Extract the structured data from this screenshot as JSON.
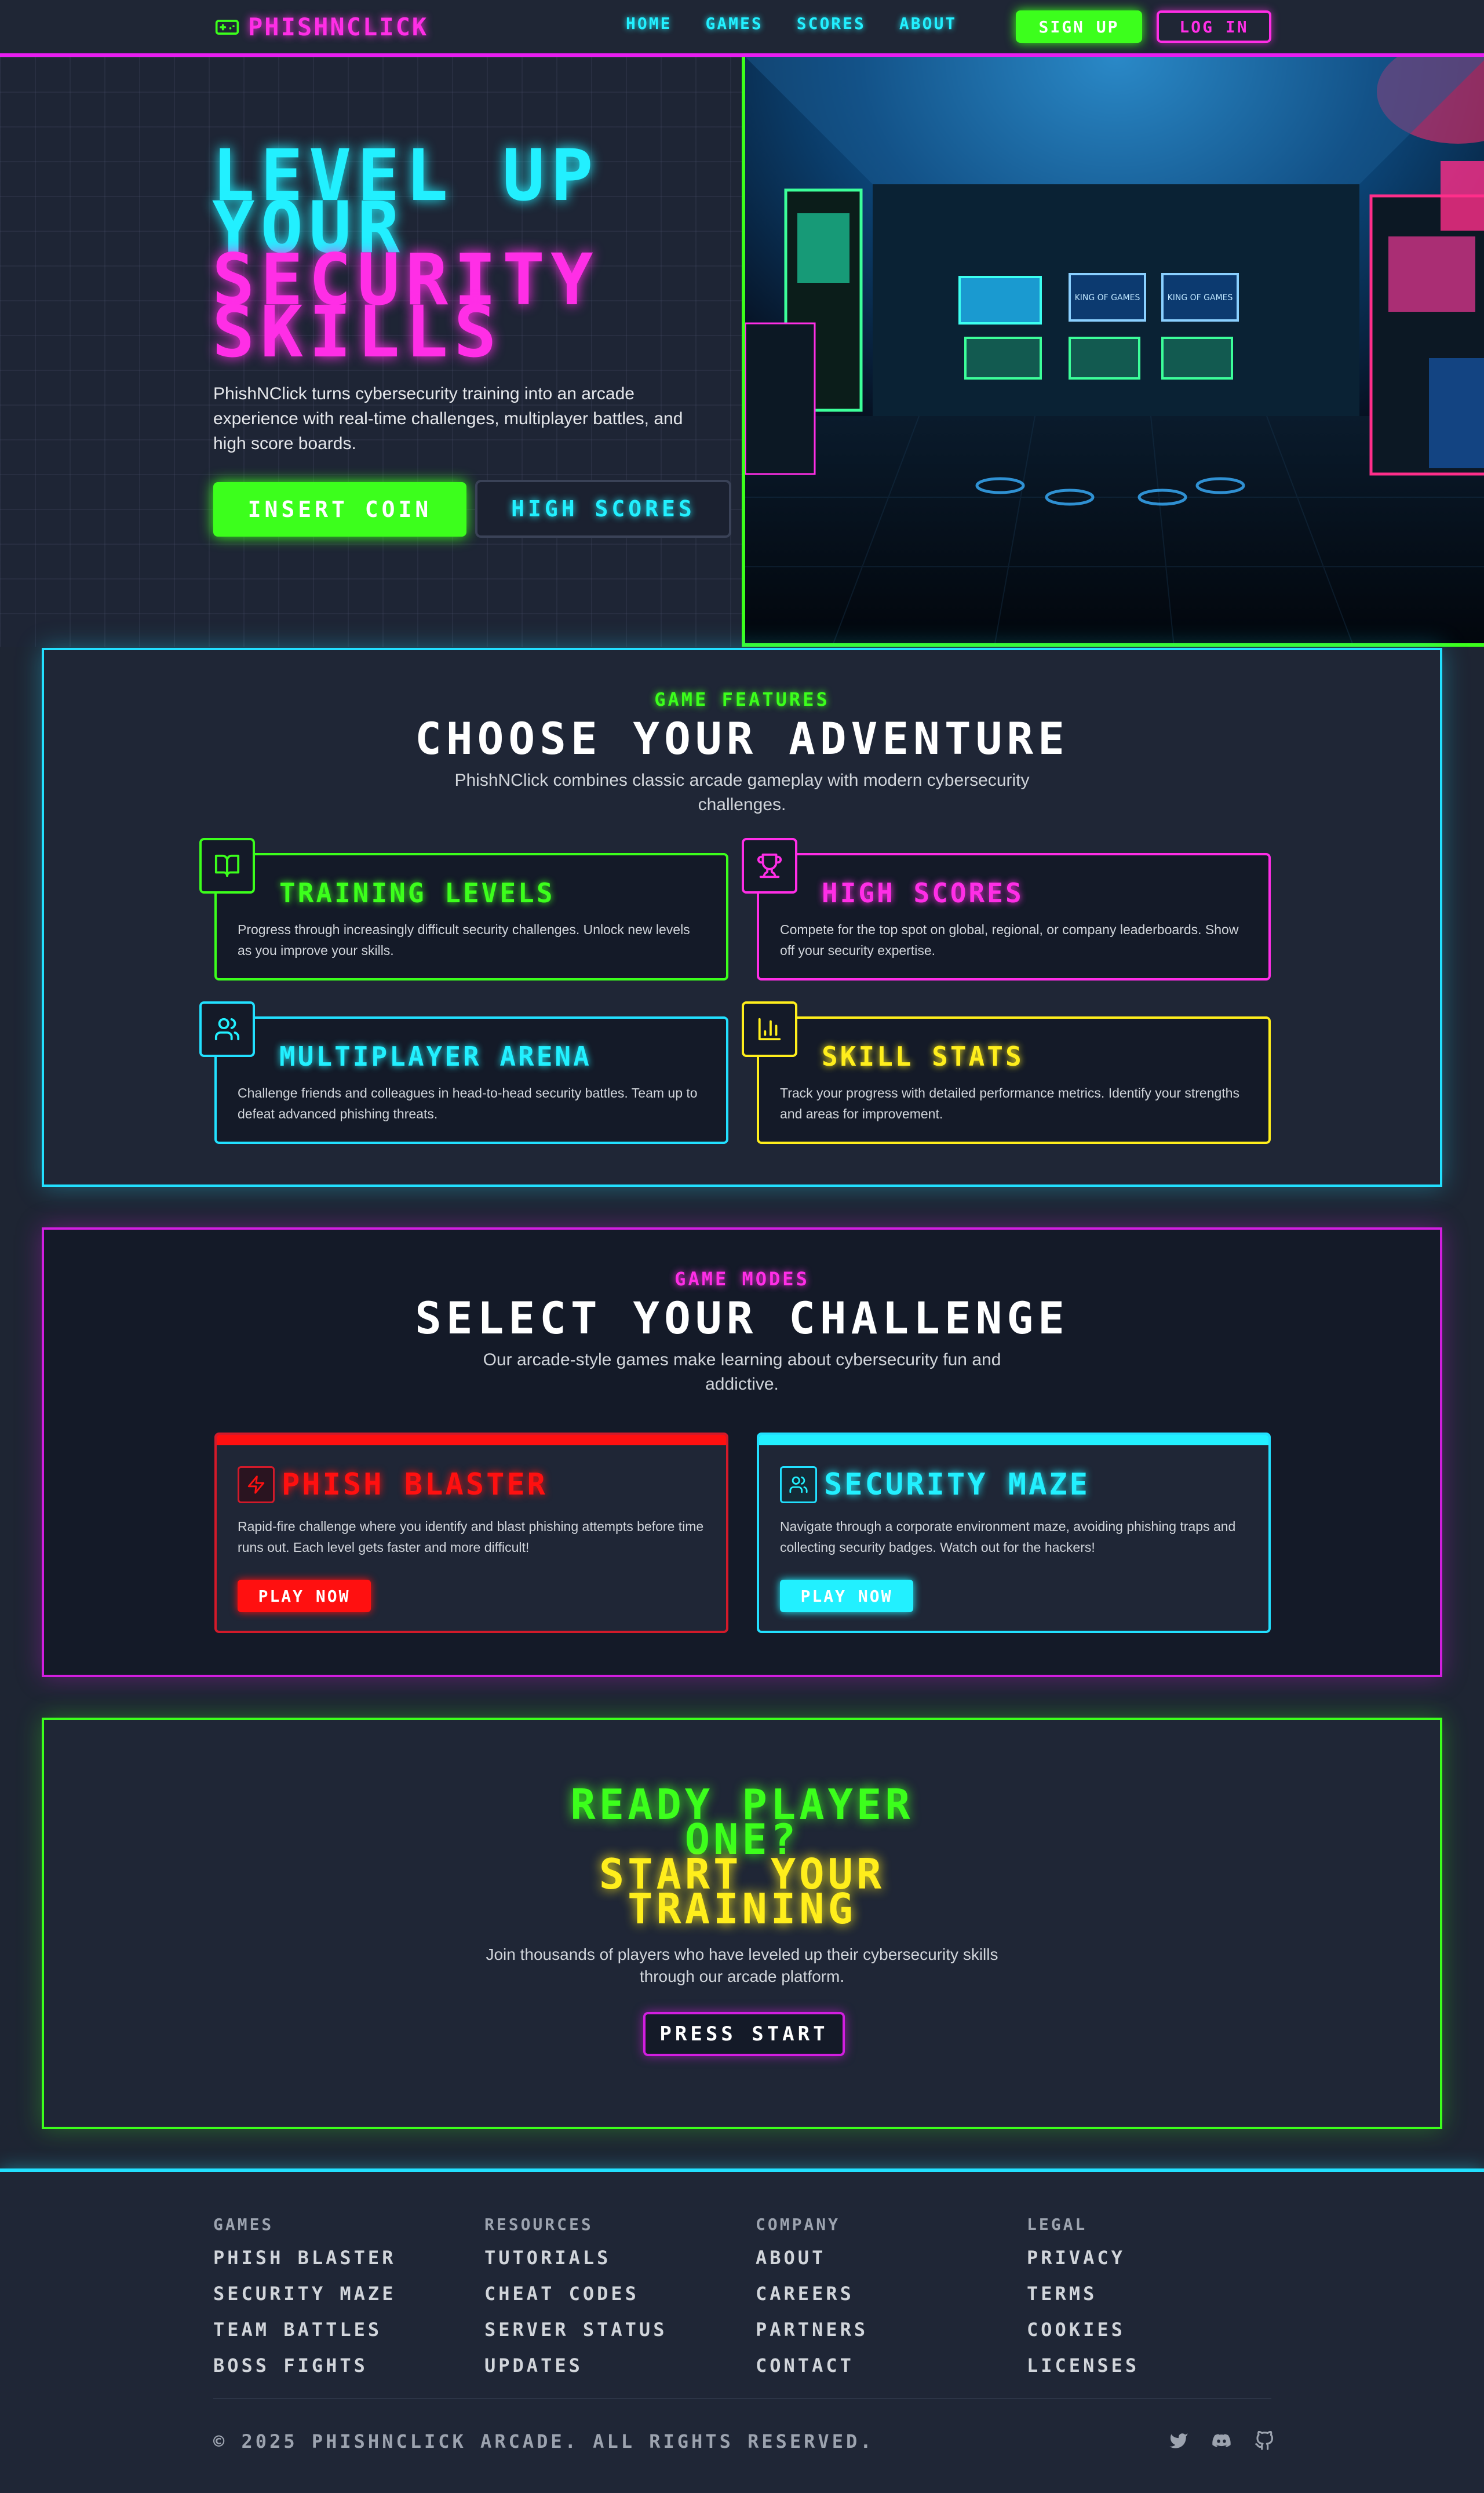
{
  "nav": {
    "logo": "PhishNClick",
    "links": [
      "HOME",
      "GAMES",
      "SCORES",
      "ABOUT"
    ],
    "signup": "SIGN UP",
    "login": "LOG IN"
  },
  "hero": {
    "title_line1": "LEVEL UP",
    "title_line2": "YOUR",
    "title_line3": "SECURITY",
    "title_line4": "SKILLS",
    "description": "PhishNClick turns cybersecurity training into an arcade experience with real-time challenges, multiplayer battles, and high score boards.",
    "primary_button": "INSERT COIN",
    "secondary_button": "HIGH SCORES",
    "screen_labels": [
      "KING OF GAMES",
      "KING OF GAMES"
    ]
  },
  "features": {
    "eyebrow": "GAME FEATURES",
    "title": "CHOOSE YOUR ADVENTURE",
    "description": "PhishNClick combines classic arcade gameplay with modern cybersecurity challenges.",
    "cards": [
      {
        "title": "TRAINING LEVELS",
        "text": "Progress through increasingly difficult security challenges. Unlock new levels as you improve your skills.",
        "icon": "book-open-icon",
        "color": "#3cff1c"
      },
      {
        "title": "HIGH SCORES",
        "text": "Compete for the top spot on global, regional, or company leaderboards. Show off your security expertise.",
        "icon": "trophy-icon",
        "color": "#ff2ee6"
      },
      {
        "title": "MULTIPLAYER ARENA",
        "text": "Challenge friends and colleagues in head-to-head security battles. Team up to defeat advanced phishing threats.",
        "icon": "users-icon",
        "color": "#22f0ff"
      },
      {
        "title": "SKILL STATS",
        "text": "Track your progress with detailed performance metrics. Identify your strengths and areas for improvement.",
        "icon": "bar-chart-icon",
        "color": "#ffee1c"
      }
    ]
  },
  "modes": {
    "eyebrow": "GAME MODES",
    "title": "SELECT YOUR CHALLENGE",
    "description": "Our arcade-style games make learning about cybersecurity fun and addictive.",
    "games": [
      {
        "title": "PHISH BLASTER",
        "text": "Rapid-fire challenge where you identify and blast phishing attempts before time runs out. Each level gets faster and more difficult!",
        "button": "PLAY NOW",
        "icon": "lightning-icon",
        "color": "#ff1010"
      },
      {
        "title": "SECURITY MAZE",
        "text": "Navigate through a corporate environment maze, avoiding phishing traps and collecting security badges. Watch out for the hackers!",
        "button": "PLAY NOW",
        "icon": "users-icon",
        "color": "#22f0ff"
      }
    ]
  },
  "cta": {
    "line1": "READY PLAYER",
    "line2": "ONE?",
    "line3": "START YOUR",
    "line4": "TRAINING",
    "description": "Join thousands of players who have leveled up their cybersecurity skills through our arcade platform.",
    "button": "PRESS START"
  },
  "footer": {
    "columns": [
      {
        "heading": "GAMES",
        "items": [
          "PHISH BLASTER",
          "SECURITY MAZE",
          "TEAM BATTLES",
          "BOSS FIGHTS"
        ]
      },
      {
        "heading": "RESOURCES",
        "items": [
          "TUTORIALS",
          "CHEAT CODES",
          "SERVER STATUS",
          "UPDATES"
        ]
      },
      {
        "heading": "COMPANY",
        "items": [
          "ABOUT",
          "CAREERS",
          "PARTNERS",
          "CONTACT"
        ]
      },
      {
        "heading": "LEGAL",
        "items": [
          "PRIVACY",
          "TERMS",
          "COOKIES",
          "LICENSES"
        ]
      }
    ],
    "copyright": "© 2025 PHISHNCLICK ARCADE. ALL RIGHTS RESERVED.",
    "socials": [
      "twitter-icon",
      "discord-icon",
      "github-icon"
    ]
  },
  "colors": {
    "green": "#3cff1c",
    "pink": "#ff2ee6",
    "cyan": "#22f0ff",
    "yellow": "#ffee1c",
    "red": "#ff1010",
    "background": "#1e2533"
  }
}
